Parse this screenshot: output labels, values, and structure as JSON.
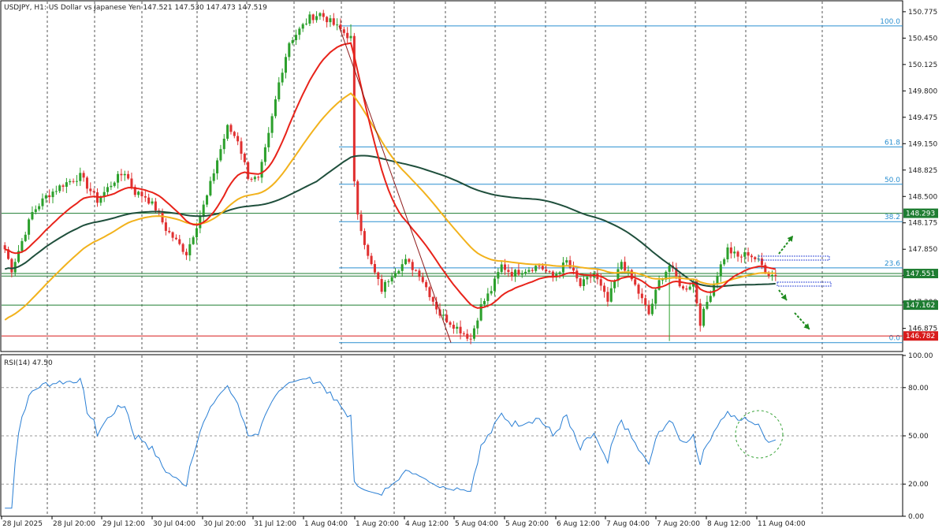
{
  "header": {
    "title": "USDJPY, H1:  US Dollar vs Japanese Yen  147.521 147.530 147.473 147.519",
    "rsi_label": "RSI(14) 47.50"
  },
  "colors": {
    "bull": "#2ca02c",
    "bear": "#e03030",
    "ma_fast": "#e8231a",
    "ma_mid": "#f2b21c",
    "ma_slow": "#1f4f3c",
    "fib": "#2a8fd0",
    "rsi": "#2a7fd4",
    "level_green": "#1e7d32",
    "level_red": "#d81b1b",
    "trend_line": "#8e1b1b",
    "arrow": "#1e8a1e",
    "grid": "#555555"
  },
  "chart_data": [
    {
      "type": "candlestick",
      "title": "USDJPY, H1:  US Dollar vs Japanese Yen",
      "ylim": [
        146.6,
        150.9
      ],
      "y_ticks": [
        "150.775",
        "150.450",
        "150.125",
        "149.800",
        "149.475",
        "149.150",
        "148.825",
        "148.500",
        "148.175",
        "147.850",
        "147.525",
        "147.200",
        "146.875"
      ],
      "x_ticks": [
        "28 Jul 2025",
        "28 Jul 20:00",
        "29 Jul 12:00",
        "30 Jul 04:00",
        "30 Jul 20:00",
        "31 Jul 12:00",
        "1 Aug 04:00",
        "1 Aug 20:00",
        "4 Aug 12:00",
        "5 Aug 04:00",
        "5 Aug 20:00",
        "6 Aug 12:00",
        "7 Aug 04:00",
        "7 Aug 20:00",
        "8 Aug 12:00",
        "11 Aug 04:00"
      ],
      "close_path": [
        [
          0,
          147.85
        ],
        [
          2,
          147.6
        ],
        [
          5,
          147.95
        ],
        [
          8,
          148.3
        ],
        [
          12,
          148.5
        ],
        [
          17,
          148.65
        ],
        [
          22,
          148.75
        ],
        [
          27,
          148.45
        ],
        [
          32,
          148.7
        ],
        [
          35,
          148.8
        ],
        [
          38,
          148.55
        ],
        [
          41,
          148.5
        ],
        [
          44,
          148.35
        ],
        [
          47,
          148.1
        ],
        [
          50,
          147.95
        ],
        [
          53,
          147.8
        ],
        [
          56,
          148.15
        ],
        [
          59,
          148.5
        ],
        [
          62,
          148.95
        ],
        [
          65,
          149.35
        ],
        [
          68,
          149.2
        ],
        [
          71,
          148.75
        ],
        [
          74,
          148.7
        ],
        [
          77,
          149.25
        ],
        [
          80,
          149.9
        ],
        [
          83,
          150.4
        ],
        [
          86,
          150.55
        ],
        [
          89,
          150.7
        ],
        [
          92,
          150.75
        ],
        [
          95,
          150.65
        ],
        [
          98,
          150.55
        ],
        [
          101,
          150.45
        ],
        [
          102,
          148.65
        ],
        [
          103,
          148.3
        ],
        [
          106,
          147.75
        ],
        [
          110,
          147.35
        ],
        [
          113,
          147.55
        ],
        [
          117,
          147.7
        ],
        [
          121,
          147.55
        ],
        [
          124,
          147.3
        ],
        [
          127,
          147.05
        ],
        [
          130,
          146.95
        ],
        [
          133,
          146.85
        ],
        [
          136,
          146.75
        ],
        [
          139,
          147.15
        ],
        [
          142,
          147.35
        ],
        [
          145,
          147.65
        ],
        [
          148,
          147.55
        ],
        [
          152,
          147.6
        ],
        [
          156,
          147.65
        ],
        [
          160,
          147.5
        ],
        [
          164,
          147.7
        ],
        [
          168,
          147.4
        ],
        [
          172,
          147.55
        ],
        [
          176,
          147.2
        ],
        [
          180,
          147.7
        ],
        [
          184,
          147.4
        ],
        [
          188,
          147.05
        ],
        [
          191,
          147.45
        ],
        [
          194,
          147.65
        ],
        [
          198,
          147.35
        ],
        [
          201,
          147.45
        ],
        [
          203,
          146.95
        ],
        [
          205,
          147.2
        ],
        [
          208,
          147.55
        ],
        [
          211,
          147.85
        ],
        [
          214,
          147.75
        ],
        [
          217,
          147.8
        ],
        [
          220,
          147.7
        ],
        [
          223,
          147.55
        ],
        [
          225,
          147.519
        ]
      ],
      "fibonacci": {
        "levels": [
          "100.0",
          "61.8",
          "50.0",
          "38.2",
          "23.6",
          "0.0"
        ],
        "high": 150.6,
        "low": 146.7
      },
      "price_tags": [
        {
          "value": 148.293,
          "label": "148.293",
          "color": "green"
        },
        {
          "value": 147.551,
          "label": "147.551",
          "color": "green"
        },
        {
          "value": 147.162,
          "label": "147.162",
          "color": "green"
        },
        {
          "value": 146.782,
          "label": "146.782",
          "color": "red"
        }
      ],
      "indicators": [
        "MA red",
        "MA orange",
        "MA dark green"
      ]
    },
    {
      "type": "line",
      "title": "RSI(14) 47.50",
      "ylim": [
        0,
        100
      ],
      "y_ticks": [
        "100.00",
        "80.00",
        "50.00",
        "20.00",
        "0.00"
      ],
      "levels": [
        80,
        50,
        20
      ],
      "series": [
        {
          "name": "RSI(14)",
          "last": 47.5
        }
      ]
    }
  ]
}
